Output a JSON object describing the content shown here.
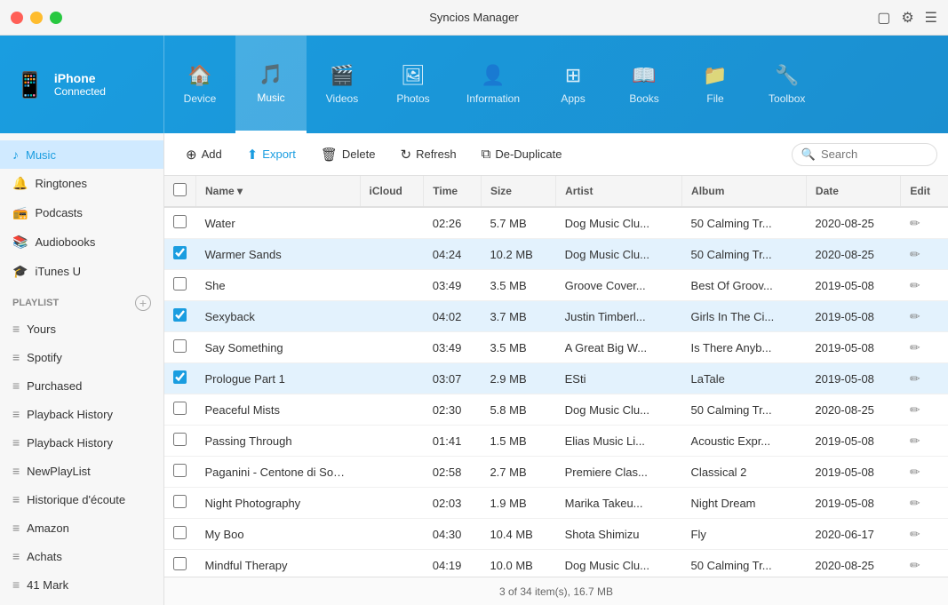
{
  "app": {
    "title": "Syncios Manager"
  },
  "titlebar": {
    "buttons": [
      "red",
      "yellow",
      "green"
    ],
    "icons": [
      "monitor",
      "settings",
      "menu"
    ]
  },
  "device": {
    "name": "iPhone",
    "status": "Connected",
    "icon": "📱"
  },
  "nav": {
    "tabs": [
      {
        "id": "device",
        "label": "Device",
        "icon": "🏠"
      },
      {
        "id": "music",
        "label": "Music",
        "icon": "🎵",
        "active": true
      },
      {
        "id": "videos",
        "label": "Videos",
        "icon": "🎬"
      },
      {
        "id": "photos",
        "label": "Photos",
        "icon": "🖼"
      },
      {
        "id": "information",
        "label": "Information",
        "icon": "👤"
      },
      {
        "id": "apps",
        "label": "Apps",
        "icon": "⊞"
      },
      {
        "id": "books",
        "label": "Books",
        "icon": "📖"
      },
      {
        "id": "file",
        "label": "File",
        "icon": "📁"
      },
      {
        "id": "toolbox",
        "label": "Toolbox",
        "icon": "🔧"
      }
    ]
  },
  "sidebar": {
    "items": [
      {
        "id": "music",
        "label": "Music",
        "icon": "♪",
        "active": true
      },
      {
        "id": "ringtones",
        "label": "Ringtones",
        "icon": "🔔"
      },
      {
        "id": "podcasts",
        "label": "Podcasts",
        "icon": "📻"
      },
      {
        "id": "audiobooks",
        "label": "Audiobooks",
        "icon": "📚"
      },
      {
        "id": "itunes-u",
        "label": "iTunes U",
        "icon": "🎓"
      }
    ],
    "playlist_section": "Playlist",
    "playlist_items": [
      {
        "id": "yours",
        "label": "Yours",
        "icon": "≡"
      },
      {
        "id": "spotify",
        "label": "Spotify",
        "icon": "≡"
      },
      {
        "id": "purchased",
        "label": "Purchased",
        "icon": "≡"
      },
      {
        "id": "playback-history-1",
        "label": "Playback History",
        "icon": "≡"
      },
      {
        "id": "playback-history-2",
        "label": "Playback History",
        "icon": "≡"
      },
      {
        "id": "newplaylist",
        "label": "NewPlayList",
        "icon": "≡"
      },
      {
        "id": "historique",
        "label": "Historique d'écoute",
        "icon": "≡"
      },
      {
        "id": "amazon",
        "label": "Amazon",
        "icon": "≡"
      },
      {
        "id": "achats",
        "label": "Achats",
        "icon": "≡"
      },
      {
        "id": "41mark",
        "label": "41 Mark",
        "icon": "≡"
      }
    ]
  },
  "toolbar": {
    "add": "Add",
    "export": "Export",
    "delete": "Delete",
    "refresh": "Refresh",
    "deduplicate": "De-Duplicate",
    "search_placeholder": "Search"
  },
  "table": {
    "columns": [
      "",
      "Name",
      "iCloud",
      "Time",
      "Size",
      "Artist",
      "Album",
      "Date",
      "Edit"
    ],
    "rows": [
      {
        "selected": false,
        "name": "Water",
        "icloud": "",
        "time": "02:26",
        "size": "5.7 MB",
        "artist": "Dog Music Clu...",
        "album": "50 Calming Tr...",
        "date": "2020-08-25"
      },
      {
        "selected": true,
        "name": "Warmer Sands",
        "icloud": "",
        "time": "04:24",
        "size": "10.2 MB",
        "artist": "Dog Music Clu...",
        "album": "50 Calming Tr...",
        "date": "2020-08-25"
      },
      {
        "selected": false,
        "name": "She",
        "icloud": "",
        "time": "03:49",
        "size": "3.5 MB",
        "artist": "Groove Cover...",
        "album": "Best Of Groov...",
        "date": "2019-05-08"
      },
      {
        "selected": true,
        "name": "Sexyback",
        "icloud": "",
        "time": "04:02",
        "size": "3.7 MB",
        "artist": "Justin Timberl...",
        "album": "Girls In The Ci...",
        "date": "2019-05-08"
      },
      {
        "selected": false,
        "name": "Say Something",
        "icloud": "",
        "time": "03:49",
        "size": "3.5 MB",
        "artist": "A Great Big W...",
        "album": "Is There Anyb...",
        "date": "2019-05-08"
      },
      {
        "selected": true,
        "name": "Prologue Part 1",
        "icloud": "",
        "time": "03:07",
        "size": "2.9 MB",
        "artist": "ESti",
        "album": "LaTale",
        "date": "2019-05-08"
      },
      {
        "selected": false,
        "name": "Peaceful Mists",
        "icloud": "",
        "time": "02:30",
        "size": "5.8 MB",
        "artist": "Dog Music Clu...",
        "album": "50 Calming Tr...",
        "date": "2020-08-25"
      },
      {
        "selected": false,
        "name": "Passing Through",
        "icloud": "",
        "time": "01:41",
        "size": "1.5 MB",
        "artist": "Elias Music Li...",
        "album": "Acoustic Expr...",
        "date": "2019-05-08"
      },
      {
        "selected": false,
        "name": "Paganini - Centone di Sonate",
        "icloud": "",
        "time": "02:58",
        "size": "2.7 MB",
        "artist": "Premiere Clas...",
        "album": "Classical 2",
        "date": "2019-05-08"
      },
      {
        "selected": false,
        "name": "Night Photography",
        "icloud": "",
        "time": "02:03",
        "size": "1.9 MB",
        "artist": "Marika Takeu...",
        "album": "Night Dream",
        "date": "2019-05-08"
      },
      {
        "selected": false,
        "name": "My Boo",
        "icloud": "",
        "time": "04:30",
        "size": "10.4 MB",
        "artist": "Shota Shimizu",
        "album": "Fly",
        "date": "2020-06-17"
      },
      {
        "selected": false,
        "name": "Mindful Therapy",
        "icloud": "",
        "time": "04:19",
        "size": "10.0 MB",
        "artist": "Dog Music Clu...",
        "album": "50 Calming Tr...",
        "date": "2020-08-25"
      }
    ]
  },
  "statusbar": {
    "text": "3 of 34 item(s), 16.7 MB"
  }
}
